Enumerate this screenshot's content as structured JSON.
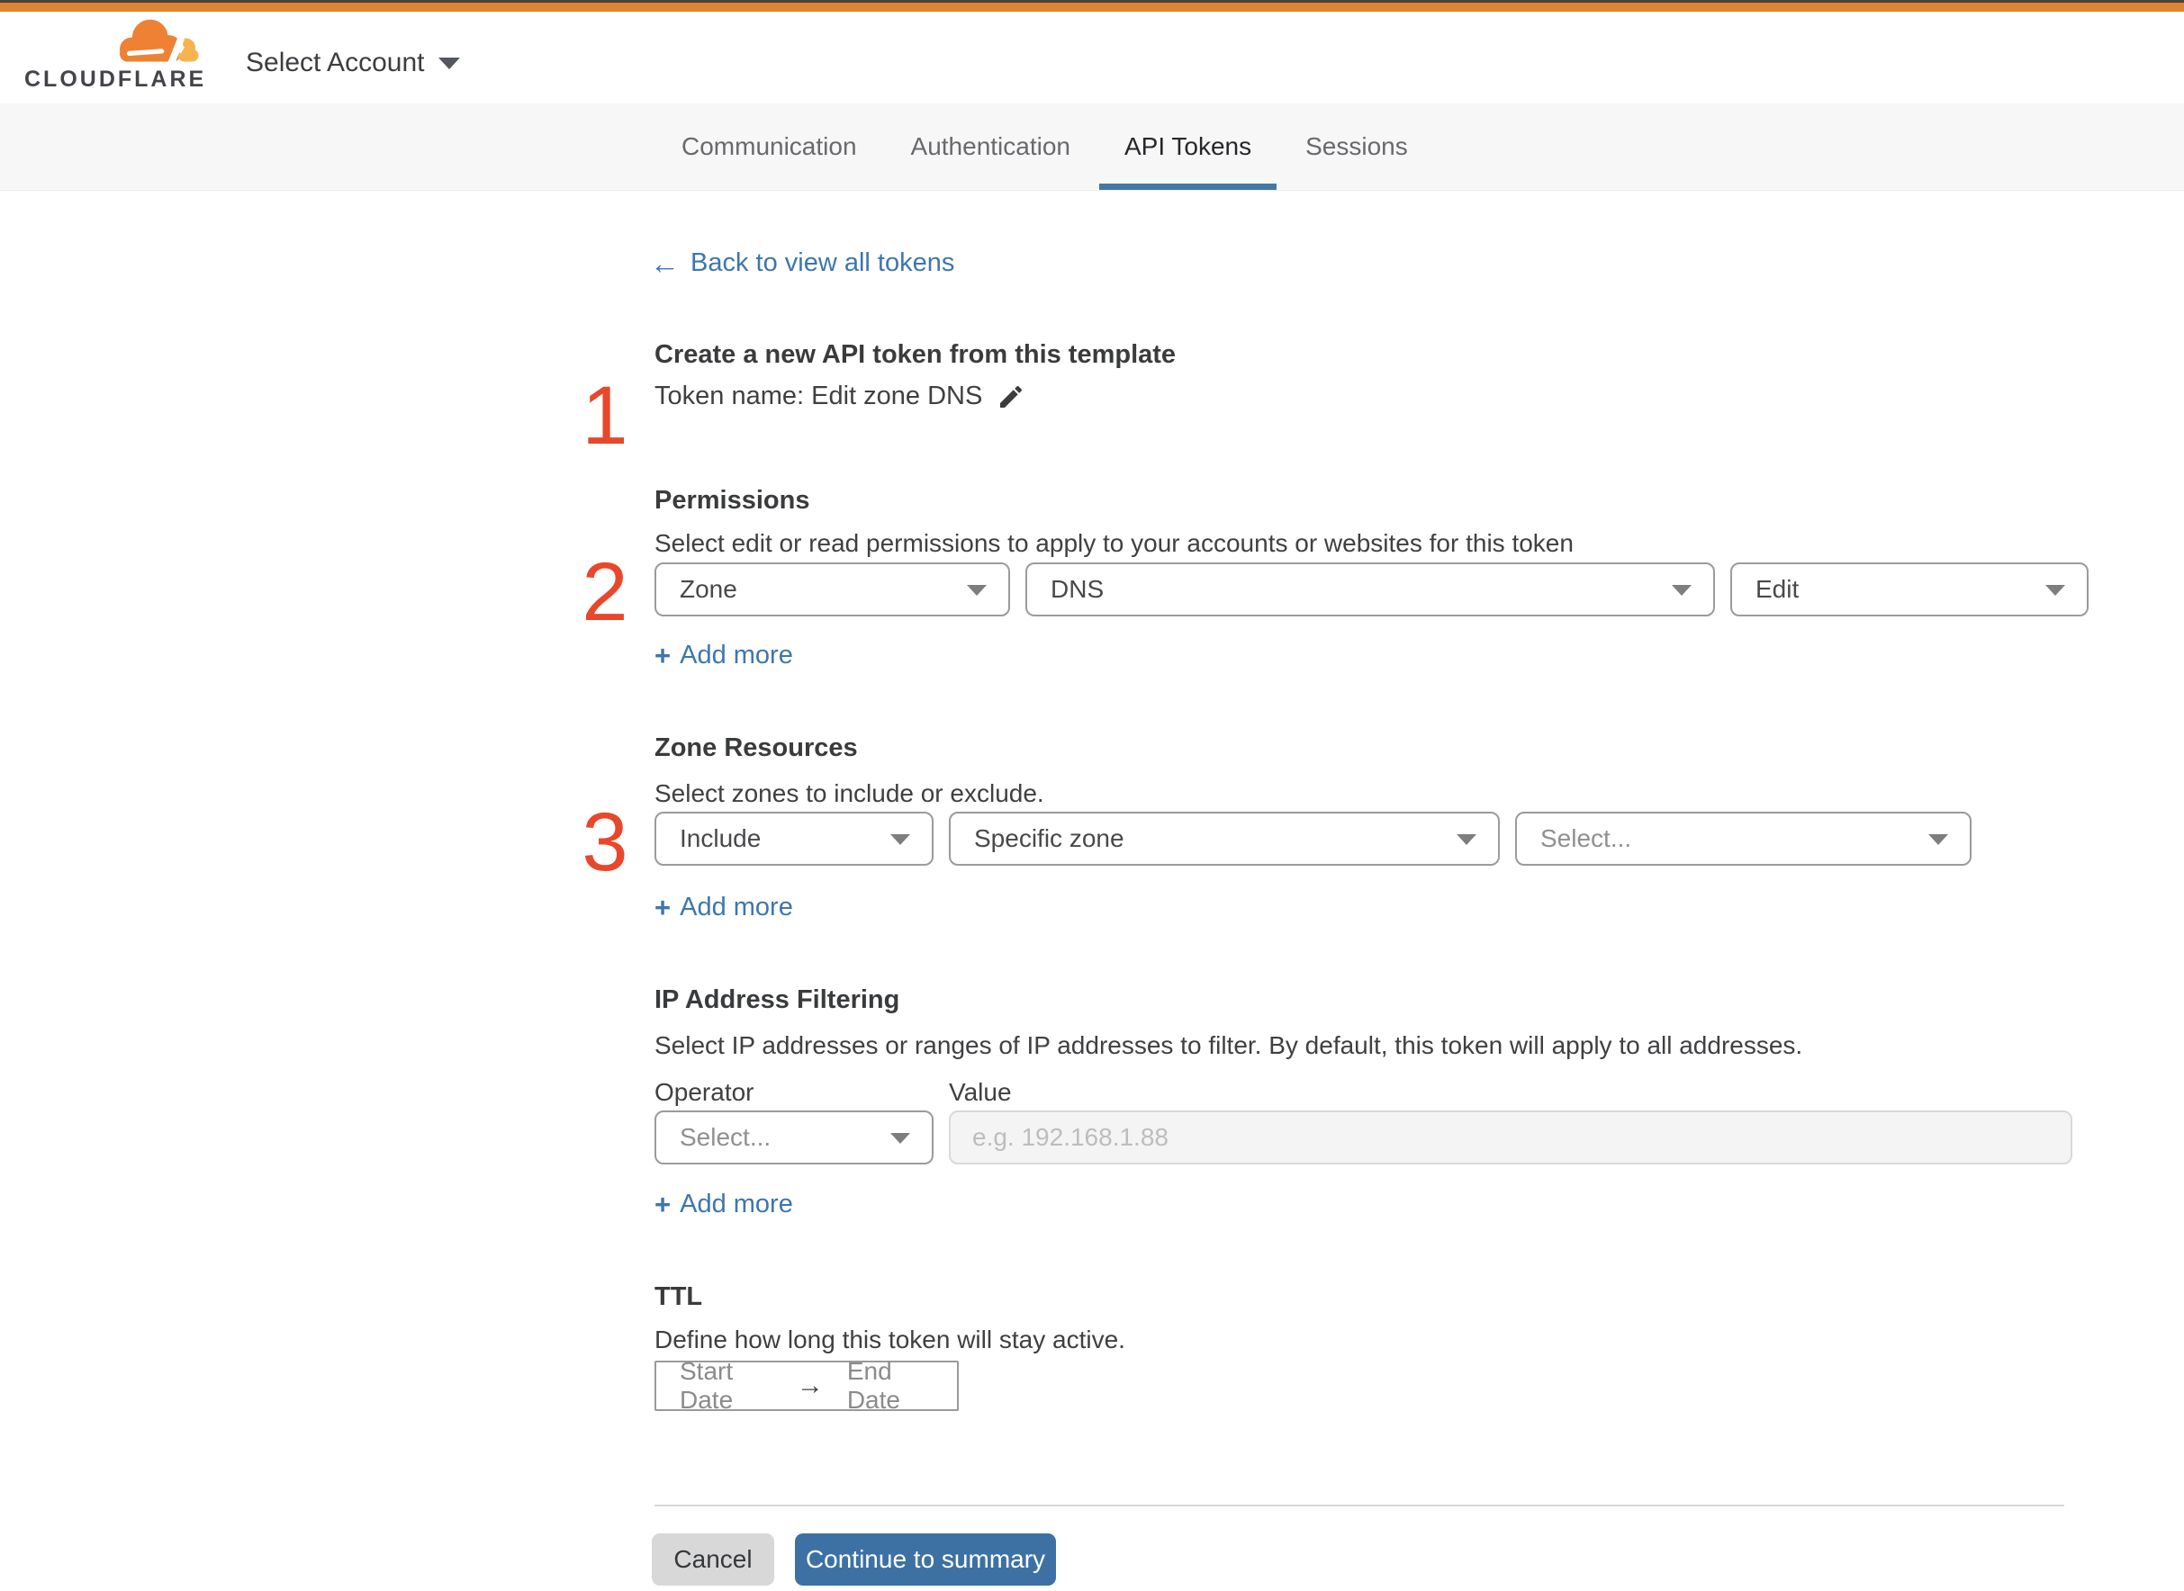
{
  "header": {
    "logo_text": "CLOUDFLARE",
    "account_selector": "Select Account"
  },
  "tabs": [
    {
      "label": "Communication"
    },
    {
      "label": "Authentication"
    },
    {
      "label": "API Tokens"
    },
    {
      "label": "Sessions"
    }
  ],
  "active_tab": "API Tokens",
  "back": {
    "arrow": "←",
    "label": "Back to view all tokens"
  },
  "markers": {
    "step1": "1",
    "step2": "2",
    "step3": "3"
  },
  "token_template": {
    "heading": "Create a new API token from this template",
    "token_name": "Token name: Edit zone DNS"
  },
  "permissions": {
    "heading": "Permissions",
    "description": "Select edit or read permissions to apply to your accounts or websites for this token",
    "scope": "Zone",
    "category": "DNS",
    "access": "Edit",
    "plus": "+",
    "add_more": "Add more"
  },
  "zone_resources": {
    "heading": "Zone Resources",
    "description": "Select zones to include or exclude.",
    "mode": "Include",
    "type": "Specific zone",
    "zone_placeholder": "Select...",
    "plus": "+",
    "add_more": "Add more"
  },
  "ip_filtering": {
    "heading": "IP Address Filtering",
    "description": "Select IP addresses or ranges of IP addresses to filter. By default, this token will apply to all addresses.",
    "operator_label": "Operator",
    "value_label": "Value",
    "operator_placeholder": "Select...",
    "value_placeholder": "e.g. 192.168.1.88",
    "plus": "+",
    "add_more": "Add more"
  },
  "ttl": {
    "heading": "TTL",
    "description": "Define how long this token will stay active.",
    "start_date": "Start Date",
    "arrow": "→",
    "end_date": "End Date"
  },
  "footer": {
    "cancel": "Cancel",
    "continue": "Continue to summary"
  },
  "colors": {
    "brand_orange": "#e0842f",
    "accent_blue": "#3d71a3",
    "link_blue": "#3e76ad",
    "marker_red": "#e9472b",
    "tabbar_bg": "#f7f7f8"
  }
}
